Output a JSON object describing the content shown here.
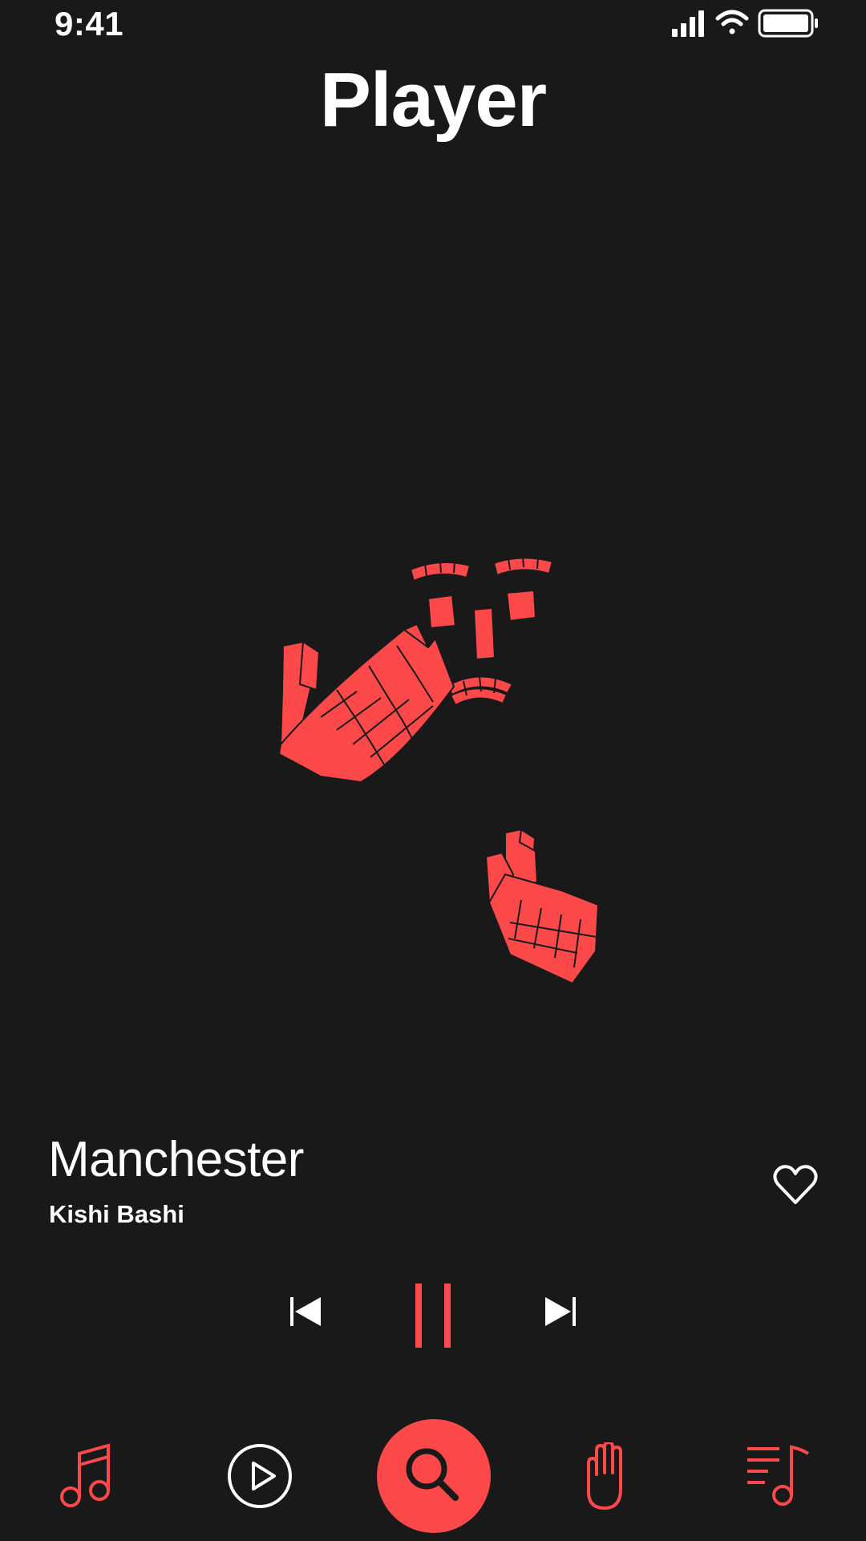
{
  "status": {
    "time": "9:41"
  },
  "header": {
    "title": "Player"
  },
  "track": {
    "title": "Manchester",
    "artist": "Kishi Bashi"
  },
  "colors": {
    "accent": "#fd494a",
    "background": "#1a191a",
    "text": "#ffffff"
  },
  "icons": {
    "status": [
      "signal-icon",
      "wifi-icon",
      "battery-icon"
    ],
    "controls": [
      "previous-icon",
      "pause-icon",
      "next-icon"
    ],
    "like": "heart-icon",
    "tabs": [
      "music-note-icon",
      "play-circle-icon",
      "search-icon",
      "hand-icon",
      "playlist-icon"
    ]
  },
  "tabbar": {
    "active_tab": "search"
  }
}
